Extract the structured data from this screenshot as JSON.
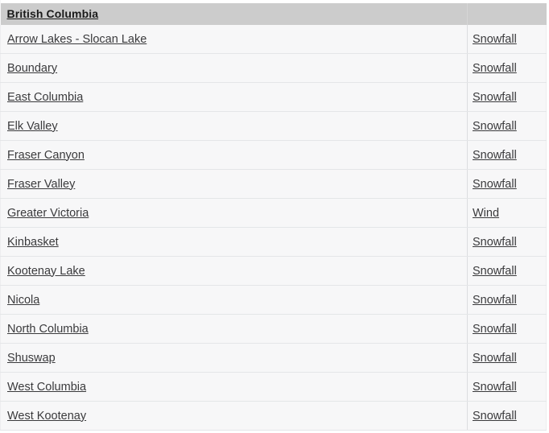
{
  "table": {
    "header": {
      "title": "British Columbia",
      "region_column_label": "",
      "hazard_column_label": ""
    },
    "rows": [
      {
        "region": "Arrow Lakes - Slocan Lake",
        "hazard": "Snowfall"
      },
      {
        "region": "Boundary",
        "hazard": "Snowfall"
      },
      {
        "region": "East Columbia",
        "hazard": "Snowfall"
      },
      {
        "region": "Elk Valley",
        "hazard": "Snowfall"
      },
      {
        "region": "Fraser Canyon",
        "hazard": "Snowfall"
      },
      {
        "region": "Fraser Valley",
        "hazard": "Snowfall"
      },
      {
        "region": "Greater Victoria",
        "hazard": "Wind"
      },
      {
        "region": "Kinbasket",
        "hazard": "Snowfall"
      },
      {
        "region": "Kootenay Lake",
        "hazard": "Snowfall"
      },
      {
        "region": "Nicola",
        "hazard": "Snowfall"
      },
      {
        "region": "North Columbia",
        "hazard": "Snowfall"
      },
      {
        "region": "Shuswap",
        "hazard": "Snowfall"
      },
      {
        "region": "West Columbia",
        "hazard": "Snowfall"
      },
      {
        "region": "West Kootenay",
        "hazard": "Snowfall"
      }
    ]
  },
  "colors": {
    "header_background": "#cccccc",
    "row_background": "#f7f7f8",
    "row_separator": "#e4e6e8",
    "link_text": "#3a3a3c",
    "header_text": "#1a1a1a",
    "page_background": "#ffffff"
  }
}
